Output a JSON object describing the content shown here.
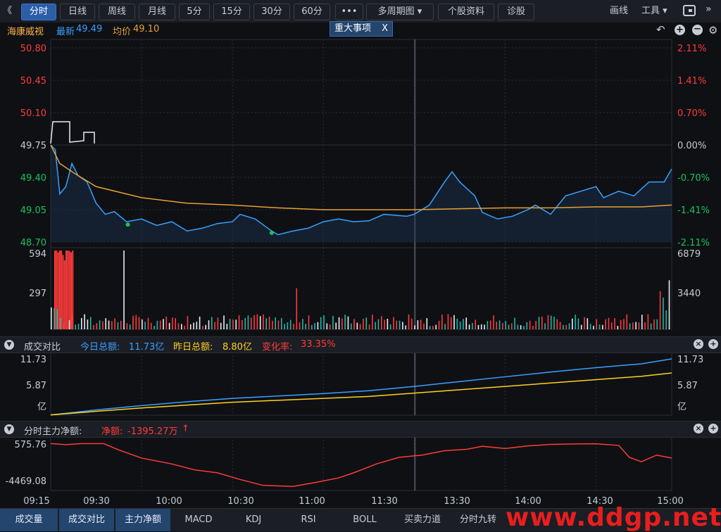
{
  "toolbar": {
    "back": "《",
    "tabs": [
      "分时",
      "日线",
      "周线",
      "月线",
      "5分",
      "15分",
      "30分",
      "60分"
    ],
    "more": "•••",
    "multi_period": "多周期图",
    "stock_info": "个股资料",
    "diagnose": "诊股",
    "draw": "画线",
    "tools": "工具",
    "window_icon": "window-icon"
  },
  "info": {
    "name": "海康威视",
    "latest_label": "最新",
    "latest_value": "49.49",
    "avg_label": "均价",
    "avg_value": "49.10",
    "events_label": "重大事项",
    "events_close": "X"
  },
  "colors": {
    "up": "#ff3b3b",
    "down": "#19c25a",
    "price": "#3aa0ff",
    "avg": "#e8a035",
    "today": "#3aa0ff",
    "yesterday": "#ffd21e",
    "net": "#ff3b3b"
  },
  "panel2": {
    "title": "成交对比",
    "today_label": "今日总额:",
    "today_value": "11.73亿",
    "yday_label": "昨日总额:",
    "yday_value": "8.80亿",
    "change_label": "变化率:",
    "change_value": "33.35%"
  },
  "panel3": {
    "title": "分时主力净额:",
    "net_label": "净额:",
    "net_value": "-1395.27万",
    "net_arrow": "↑"
  },
  "chart_data": [
    {
      "type": "line",
      "name": "price",
      "x": [
        "09:30",
        "10:00",
        "10:30",
        "11:00",
        "11:30",
        "13:30",
        "14:00",
        "14:30",
        "15:00"
      ],
      "y_ticks_left": [
        "50.80",
        "50.45",
        "50.10",
        "49.75",
        "49.40",
        "49.05",
        "48.70"
      ],
      "y_ticks_right": [
        "2.11%",
        "1.41%",
        "0.70%",
        "0.00%",
        "-0.70%",
        "-1.41%",
        "-2.11%"
      ],
      "ylim": [
        48.7,
        50.8
      ],
      "prev_close": 49.75,
      "series": [
        {
          "name": "最新",
          "values": [
            [
              0,
              49.75
            ],
            [
              3,
              49.7
            ],
            [
              6,
              49.22
            ],
            [
              10,
              49.3
            ],
            [
              14,
              49.55
            ],
            [
              18,
              49.42
            ],
            [
              24,
              49.35
            ],
            [
              30,
              49.12
            ],
            [
              36,
              49.0
            ],
            [
              42,
              49.03
            ],
            [
              50,
              48.92
            ],
            [
              60,
              48.95
            ],
            [
              70,
              48.88
            ],
            [
              80,
              48.92
            ],
            [
              90,
              48.82
            ],
            [
              100,
              48.85
            ],
            [
              110,
              48.9
            ],
            [
              120,
              48.92
            ],
            [
              125,
              49.0
            ],
            [
              135,
              48.95
            ],
            [
              145,
              48.83
            ],
            [
              150,
              48.78
            ],
            [
              160,
              48.82
            ],
            [
              170,
              48.85
            ],
            [
              180,
              48.92
            ],
            [
              190,
              48.95
            ],
            [
              200,
              48.92
            ],
            [
              210,
              48.93
            ],
            [
              220,
              49.0
            ],
            [
              235,
              48.98
            ],
            [
              240,
              49.0
            ],
            [
              250,
              49.1
            ],
            [
              260,
              49.35
            ],
            [
              265,
              49.46
            ],
            [
              270,
              49.35
            ],
            [
              280,
              49.2
            ],
            [
              285,
              49.02
            ],
            [
              295,
              48.95
            ],
            [
              305,
              48.98
            ],
            [
              315,
              49.05
            ],
            [
              320,
              49.1
            ],
            [
              330,
              49.0
            ],
            [
              340,
              49.2
            ],
            [
              350,
              49.25
            ],
            [
              360,
              49.3
            ],
            [
              365,
              49.18
            ],
            [
              375,
              49.25
            ],
            [
              385,
              49.2
            ],
            [
              395,
              49.35
            ],
            [
              405,
              49.35
            ],
            [
              410,
              49.49
            ]
          ]
        },
        {
          "name": "均价",
          "values": [
            [
              0,
              49.75
            ],
            [
              6,
              49.55
            ],
            [
              15,
              49.45
            ],
            [
              30,
              49.3
            ],
            [
              60,
              49.18
            ],
            [
              90,
              49.12
            ],
            [
              120,
              49.1
            ],
            [
              150,
              49.07
            ],
            [
              180,
              49.05
            ],
            [
              210,
              49.05
            ],
            [
              240,
              49.05
            ],
            [
              270,
              49.06
            ],
            [
              300,
              49.07
            ],
            [
              330,
              49.07
            ],
            [
              360,
              49.08
            ],
            [
              390,
              49.08
            ],
            [
              410,
              49.1
            ]
          ]
        }
      ]
    },
    {
      "type": "bar",
      "name": "volume",
      "y_ticks_left": [
        "594",
        "297"
      ],
      "y_ticks_right": [
        "6879",
        "3440"
      ],
      "ylim": [
        0,
        594
      ]
    },
    {
      "type": "line",
      "name": "turnover_compare",
      "y_ticks_left": [
        "11.73",
        "5.87",
        "亿"
      ],
      "y_ticks_right": [
        "11.73",
        "5.87",
        "亿"
      ],
      "ylim": [
        0,
        11.73
      ],
      "series": [
        {
          "name": "今日总额",
          "values": [
            [
              0,
              0.05
            ],
            [
              30,
              1.1
            ],
            [
              60,
              2.0
            ],
            [
              90,
              2.8
            ],
            [
              120,
              3.5
            ],
            [
              150,
              4.0
            ],
            [
              180,
              4.5
            ],
            [
              210,
              5.1
            ],
            [
              240,
              6.0
            ],
            [
              270,
              7.0
            ],
            [
              300,
              8.0
            ],
            [
              330,
              9.0
            ],
            [
              360,
              9.9
            ],
            [
              390,
              10.7
            ],
            [
              410,
              11.73
            ]
          ]
        },
        {
          "name": "昨日总额",
          "values": [
            [
              0,
              0.05
            ],
            [
              30,
              0.8
            ],
            [
              60,
              1.5
            ],
            [
              90,
              2.1
            ],
            [
              120,
              2.7
            ],
            [
              150,
              3.1
            ],
            [
              180,
              3.5
            ],
            [
              210,
              3.9
            ],
            [
              240,
              4.6
            ],
            [
              270,
              5.3
            ],
            [
              300,
              6.0
            ],
            [
              330,
              6.7
            ],
            [
              360,
              7.4
            ],
            [
              390,
              8.1
            ],
            [
              410,
              8.8
            ]
          ]
        }
      ]
    },
    {
      "type": "line",
      "name": "main_net",
      "y_ticks_left": [
        "575.76",
        "-4469.08"
      ],
      "ylim": [
        -5800,
        600
      ],
      "series": [
        {
          "name": "净额",
          "values": [
            [
              0,
              560
            ],
            [
              10,
              420
            ],
            [
              20,
              560
            ],
            [
              35,
              560
            ],
            [
              45,
              -300
            ],
            [
              60,
              -1400
            ],
            [
              80,
              -2200
            ],
            [
              95,
              -3000
            ],
            [
              110,
              -3400
            ],
            [
              125,
              -4300
            ],
            [
              140,
              -5100
            ],
            [
              160,
              -5250
            ],
            [
              175,
              -4700
            ],
            [
              190,
              -4100
            ],
            [
              200,
              -3400
            ],
            [
              215,
              -2200
            ],
            [
              230,
              -1300
            ],
            [
              245,
              -1000
            ],
            [
              260,
              -400
            ],
            [
              275,
              -200
            ],
            [
              285,
              200
            ],
            [
              300,
              -100
            ],
            [
              315,
              250
            ],
            [
              330,
              460
            ],
            [
              345,
              520
            ],
            [
              360,
              540
            ],
            [
              375,
              320
            ],
            [
              382,
              -1300
            ],
            [
              390,
              -1900
            ],
            [
              400,
              -1000
            ],
            [
              410,
              -1395
            ]
          ]
        }
      ]
    }
  ],
  "x_axis_labels": [
    "09:15",
    "09:30",
    "10:00",
    "10:30",
    "11:00",
    "11:30",
    "13:30",
    "14:00",
    "14:30",
    "15:00"
  ],
  "bottom_tabs": [
    "成交量",
    "成交对比",
    "主力净额",
    "MACD",
    "KDJ",
    "RSI",
    "BOLL",
    "买卖力道",
    "分时九转"
  ],
  "watermark": "www.ddgp.net"
}
